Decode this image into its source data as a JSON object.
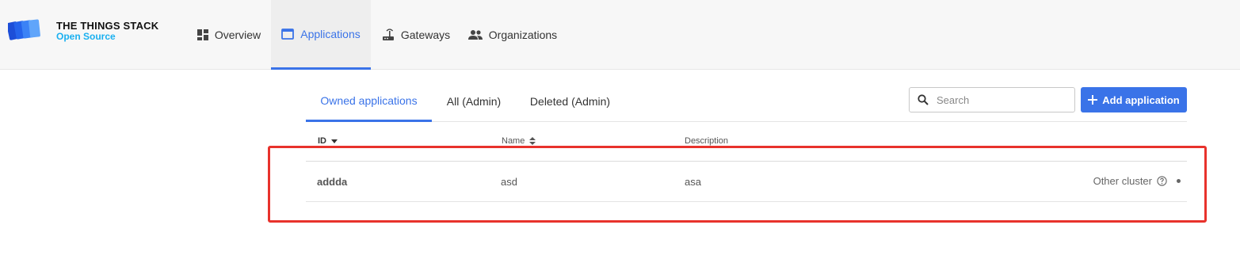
{
  "brand": {
    "title": "THE THINGS STACK",
    "subtitle": "Open Source",
    "title_color": "#111111",
    "subtitle_color": "#1ab0f0"
  },
  "nav": {
    "items": [
      {
        "label": "Overview",
        "icon": "dashboard-icon",
        "active": false
      },
      {
        "label": "Applications",
        "icon": "window-icon",
        "active": true
      },
      {
        "label": "Gateways",
        "icon": "router-icon",
        "active": false
      },
      {
        "label": "Organizations",
        "icon": "people-icon",
        "active": false
      }
    ]
  },
  "tabs": [
    {
      "label": "Owned applications",
      "active": true
    },
    {
      "label": "All (Admin)",
      "active": false
    },
    {
      "label": "Deleted (Admin)",
      "active": false
    }
  ],
  "search": {
    "placeholder": "Search",
    "value": ""
  },
  "add_button": {
    "label": "Add application"
  },
  "table": {
    "columns": [
      {
        "label": "ID",
        "sort": "descending"
      },
      {
        "label": "Name",
        "sort": "unsorted"
      },
      {
        "label": "Description",
        "sort": "none"
      }
    ],
    "rows": [
      {
        "id": "addda",
        "name": "asd",
        "description": "asa",
        "status": "Other cluster"
      }
    ]
  },
  "colors": {
    "accent": "#3a73e8",
    "highlight": "#e8322c"
  }
}
